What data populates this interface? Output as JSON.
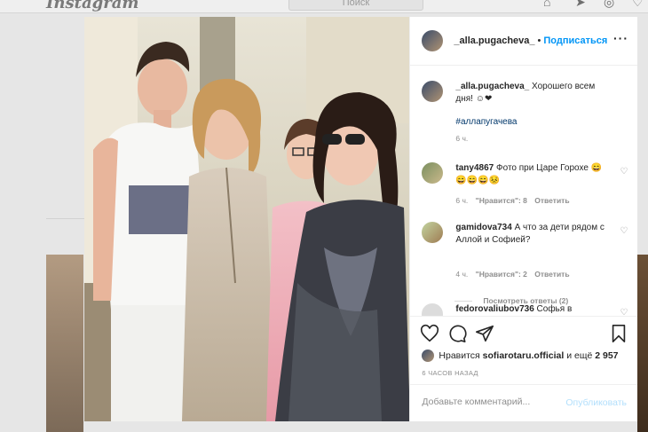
{
  "background": {
    "logo": "Instagram",
    "search_placeholder": "Поиск"
  },
  "post": {
    "username": "_alla.pugacheva_",
    "dot": "•",
    "follow_label": "Подписаться",
    "more_icon": "more-horizontal-icon",
    "caption": {
      "username": "_alla.pugacheva_",
      "text": "Хорошего всем дня! ☺❤",
      "hashtag": "#аллапугачева",
      "time": "6 ч."
    },
    "comments": [
      {
        "username": "tany4867",
        "text": "Фото при Царе Горохе 😄😄😄😄😣",
        "time": "6 ч.",
        "likes": "\"Нравится\": 8",
        "reply": "Ответить"
      },
      {
        "username": "gamidova734",
        "text": "А что за дети рядом с Аллой и Софией?",
        "time": "4 ч.",
        "likes": "\"Нравится\": 2",
        "reply": "Ответить",
        "show_replies": "Посмотреть ответы (2)"
      },
      {
        "username": "fedorovaliubov736",
        "text": "Софья в"
      }
    ],
    "liked_by_prefix": "Нравится",
    "liked_by_user": "sofiarotaru.official",
    "liked_by_and": "и ещё",
    "liked_by_count": "2 957",
    "timestamp": "6 ЧАСОВ НАЗАД",
    "comment_placeholder": "Добавьте комментарий...",
    "publish_label": "Опубликовать"
  },
  "colors": {
    "link_blue": "#0095f6",
    "publish_disabled": "#b2dffc",
    "heart_red": "#ed4956"
  }
}
